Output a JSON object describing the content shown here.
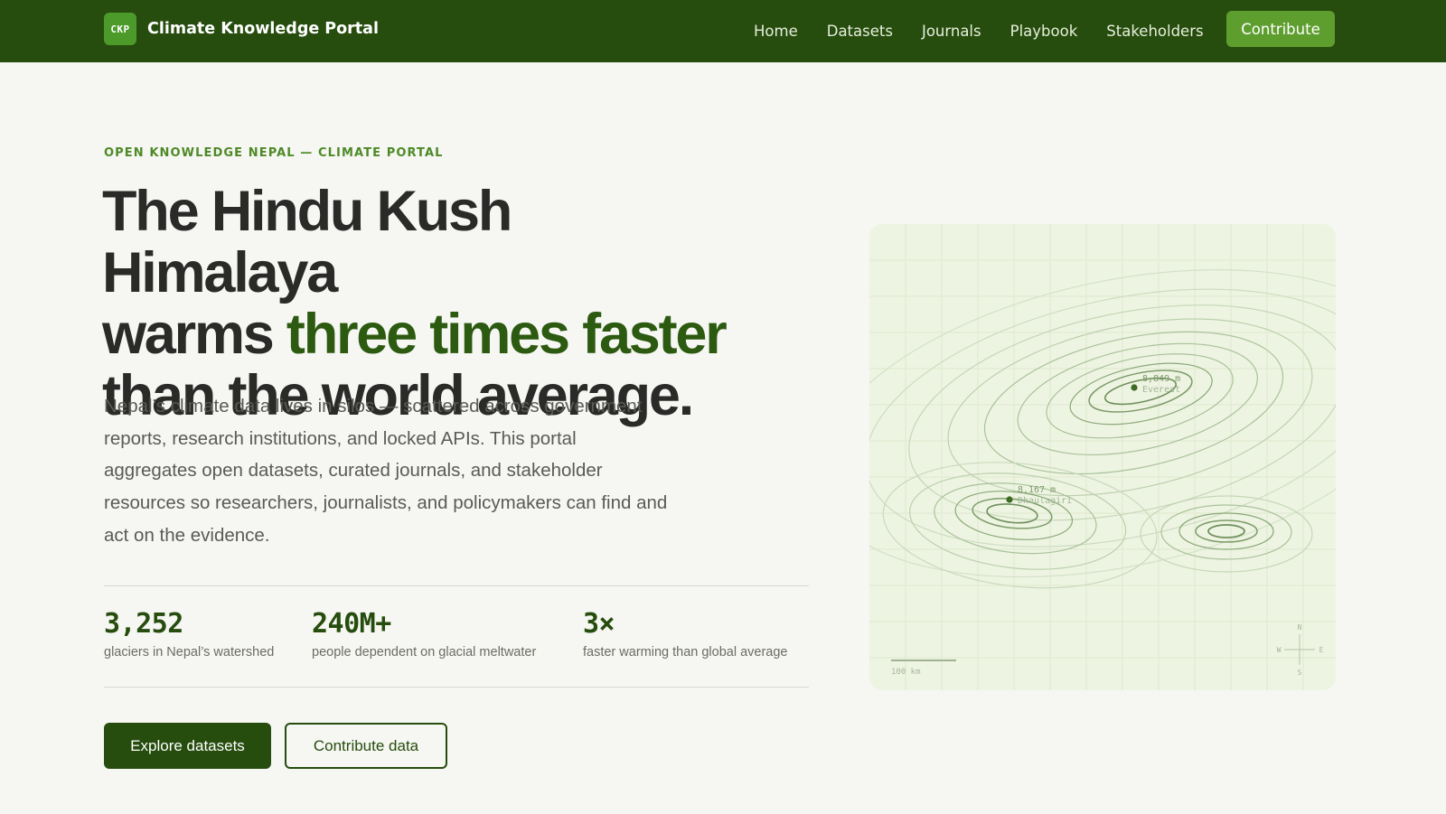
{
  "header": {
    "logo_text": "CKP",
    "site_name": "Climate Knowledge Portal",
    "nav": [
      "Home",
      "Datasets",
      "Journals",
      "Playbook",
      "Stakeholders"
    ],
    "cta_label": "Contribute"
  },
  "hero": {
    "eyebrow": "OPEN KNOWLEDGE NEPAL — CLIMATE PORTAL",
    "headline_line1": "The Hindu Kush Himalaya",
    "headline_line2_prefix": "warms ",
    "headline_accent": "three times faster",
    "headline_line3": "than the world average.",
    "lead": "Nepal’s climate data lives in silos — scattered across government reports, research institutions, and locked APIs. This portal aggregates open datasets, curated journals, and stakeholder resources so researchers, journalists, and policymakers can find and act on the evidence.",
    "stats": [
      {
        "value": "3,252",
        "label": "glaciers in Nepal’s watershed"
      },
      {
        "value": "240M+",
        "label": "people dependent on glacial meltwater"
      },
      {
        "value": "3×",
        "label": "faster warming than global average"
      }
    ],
    "primary_button": "Explore datasets",
    "secondary_button": "Contribute data"
  },
  "map": {
    "peaks": [
      {
        "elevation": "8,849 m",
        "name": "Everest"
      },
      {
        "elevation": "8,167 m",
        "name": "Dhaulagiri"
      }
    ],
    "scale_label": "100 km",
    "compass": {
      "n": "N",
      "s": "S",
      "e": "E",
      "w": "W"
    },
    "colors": {
      "background": "#eef4e2",
      "contour": "#9bb58a",
      "peak": "#3d6b22"
    }
  },
  "colors": {
    "header_bg": "#264d0d",
    "accent": "#5e9e2f",
    "headline_accent": "#2c5a10",
    "page_bg": "#f6f6f3"
  }
}
